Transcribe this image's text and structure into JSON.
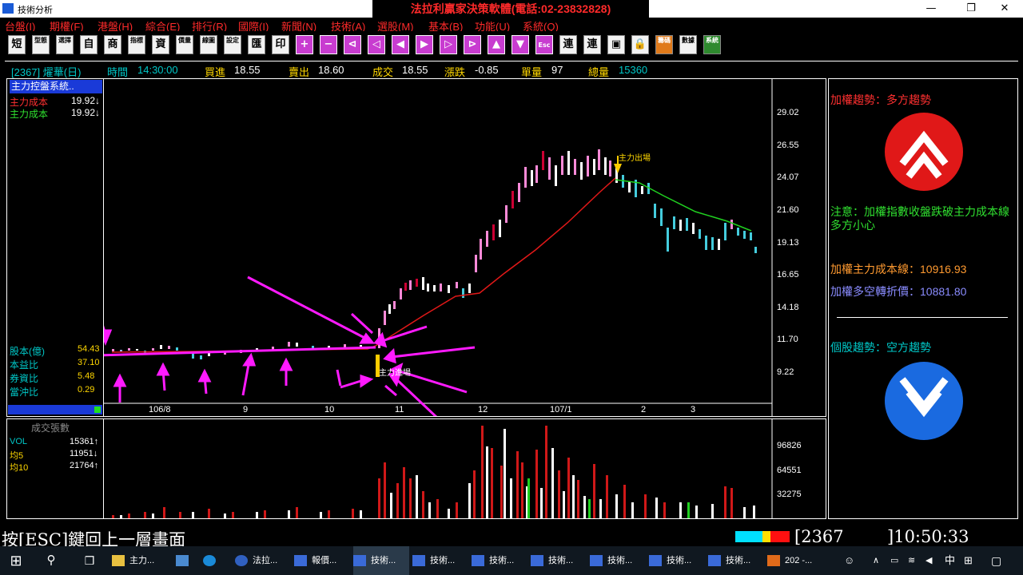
{
  "window": {
    "title": "技術分析",
    "banner": "法拉利贏家決策軟體(電話:02-23832828)",
    "controls": [
      "—",
      "❐",
      "✕"
    ]
  },
  "menu": [
    "台盤(I)",
    "期權(F)",
    "港盤(H)",
    "綜合(E)",
    "排行(R)",
    "國際(I)",
    "新聞(N)",
    "技術(A)",
    "選股(M)",
    "基本(B)",
    "功能(U)",
    "系統(Q)"
  ],
  "toolbar": {
    "buttons": [
      "短",
      "型態",
      "選擇",
      "自",
      "商",
      "指標",
      "資",
      "價量",
      "線圖",
      "設定",
      "匯",
      "印",
      "+",
      "−",
      "⊲",
      "◁",
      "◀",
      "▶",
      "▷",
      "⊳",
      "▲",
      "▼",
      "Esc",
      "連",
      "連",
      "▣",
      "🔒",
      "籌碼",
      "數據",
      "系統"
    ]
  },
  "quote": {
    "code_name": "[2367] 燿華(日)",
    "time_label": "時間",
    "time": "14:30:00",
    "bid_label": "買進",
    "bid": "18.55",
    "ask_label": "賣出",
    "ask": "18.60",
    "deal_label": "成交",
    "deal": "18.55",
    "change_label": "漲跌",
    "change": "-0.85",
    "unit_label": "單量",
    "unit": "97",
    "total_label": "總量",
    "total": "15360"
  },
  "left_panel": {
    "title": "主力控盤系統..",
    "cost1_label": "主力成本",
    "cost1": "19.92↓",
    "cost2_label": "主力成本",
    "cost2": "19.92↓",
    "capital_label": "股本(億)",
    "capital": "54.43",
    "pe_label": "本益比",
    "pe": "37.10",
    "margin_label": "券資比",
    "margin": "5.48",
    "daytrade_label": "當沖比",
    "daytrade": "0.29"
  },
  "chart_data": {
    "type": "candlestick",
    "y_ticks": [
      "29.02",
      "26.55",
      "24.07",
      "21.60",
      "19.13",
      "16.65",
      "14.18",
      "11.70",
      "9.22"
    ],
    "x_ticks": [
      "106/8",
      "9",
      "10",
      "11",
      "12",
      "107/1",
      "2",
      "3"
    ],
    "annotations": {
      "enter": "主力進場",
      "exit": "主力出場"
    },
    "volume_panel": {
      "title": "成交張數",
      "vol_label": "VOL",
      "vol": "15361↑",
      "ma5_label": "均5",
      "ma5": "11951↓",
      "ma10_label": "均10",
      "ma10": "21764↑",
      "y_ticks": [
        "96826",
        "64551",
        "32275"
      ]
    }
  },
  "right_panel": {
    "index_trend": "加權趨勢：多方趨勢",
    "notice": "注意：加權指數收盤跌破主力成本線多方小心",
    "cost_line": "加權主力成本線：10916.93",
    "turn_price": "加權多空轉折價：10881.80",
    "stock_trend": "個股趨勢：空方趨勢"
  },
  "status": {
    "hint": "按[ESC]鍵回上一層畫面",
    "code": "2367",
    "clock": "10:50:33"
  },
  "taskbar": {
    "items": [
      "主力...",
      "法拉...",
      "報價...",
      "技術...",
      "技術...",
      "技術...",
      "技術...",
      "技術...",
      "技術...",
      "技術...",
      "202 -..."
    ],
    "ime": "中"
  }
}
